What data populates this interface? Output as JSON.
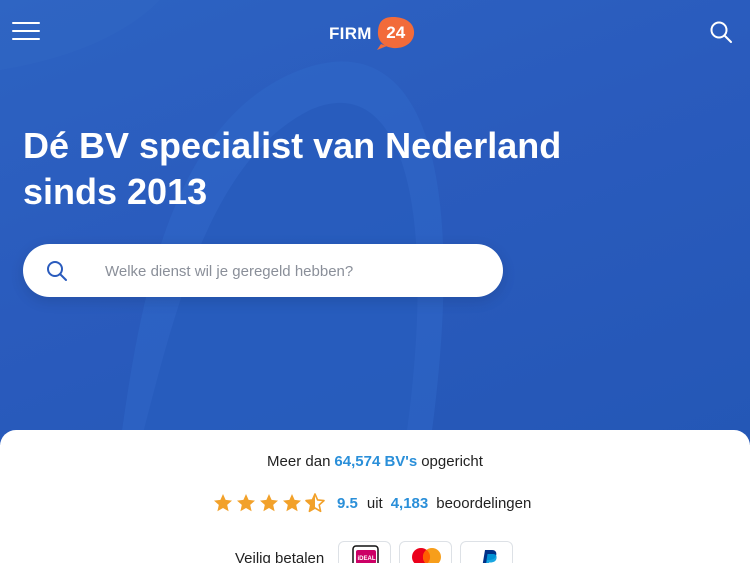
{
  "header": {
    "logo_text": "FIRM",
    "logo_number": "24",
    "menu_icon": "hamburger-menu-icon",
    "search_icon": "search-icon"
  },
  "hero": {
    "headline": "Dé BV specialist van Nederland sinds 2013",
    "search": {
      "placeholder": "Welke dienst wil je geregeld hebben?",
      "value": ""
    }
  },
  "stats": {
    "prefix": "Meer dan",
    "count": "64,574 BV's",
    "suffix": "opgericht"
  },
  "rating": {
    "stars": 4.5,
    "score": "9.5",
    "connector": "uit",
    "reviews": "4,183",
    "label": "beoordelingen"
  },
  "payment": {
    "label": "Veilig betalen",
    "methods": [
      "iDEAL",
      "Mastercard",
      "PayPal"
    ],
    "ideal_badge": "iDEAL"
  },
  "colors": {
    "hero_blue": "#2a5bbd",
    "accent_blue": "#2a8fd9",
    "logo_orange": "#f26b3a",
    "star_orange": "#f2a12a"
  }
}
